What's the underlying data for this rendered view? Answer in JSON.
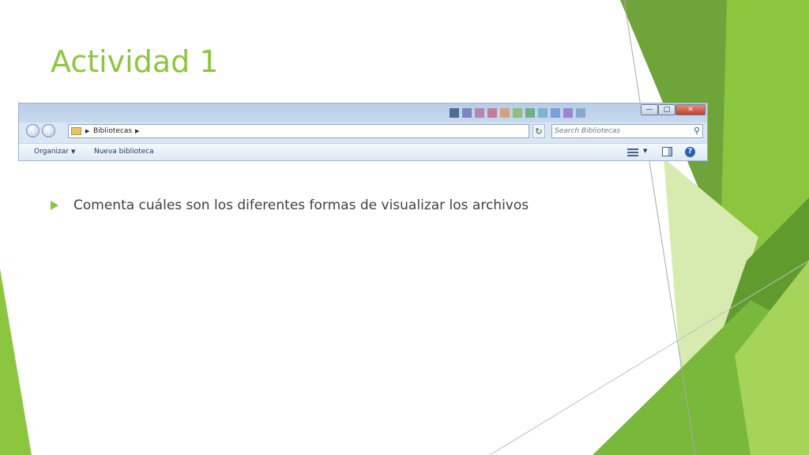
{
  "slide": {
    "title": "Actividad 1",
    "bullet_text": "Comenta cuáles son los diferentes formas de visualizar los archivos",
    "accent_color": "#8cc63f"
  },
  "explorer": {
    "breadcrumb": "Bibliotecas",
    "search_placeholder": "Search Bibliotecas",
    "toolbar": {
      "organize_label": "Organizar",
      "new_library_label": "Nueva biblioteca"
    },
    "icons": {
      "back": "back-arrow-icon",
      "forward": "forward-arrow-icon",
      "folder": "folder-icon",
      "refresh": "refresh-icon",
      "search": "search-icon",
      "view": "view-options-icon",
      "preview_pane": "preview-pane-icon",
      "help": "help-icon"
    }
  }
}
